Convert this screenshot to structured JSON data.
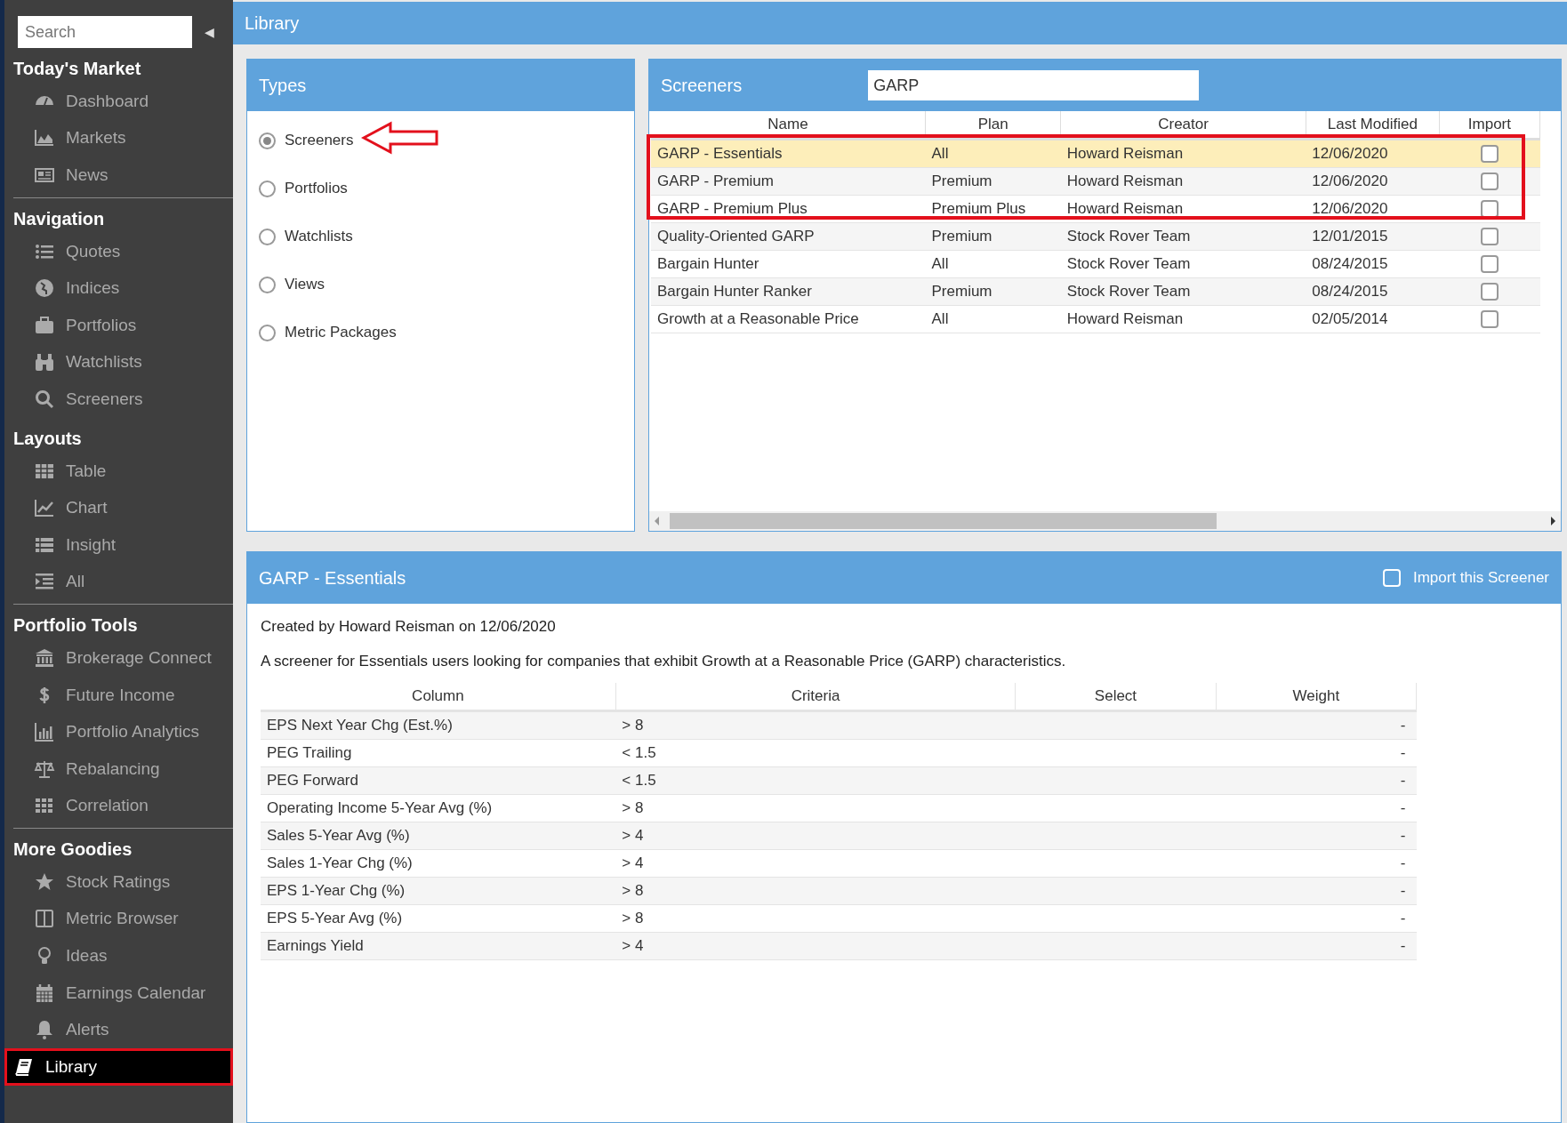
{
  "sidebar": {
    "search": {
      "placeholder": "Search"
    },
    "collapse": "◀",
    "sections": [
      {
        "title": "Today's Market",
        "items": [
          {
            "label": "Dashboard",
            "selected": false
          },
          {
            "label": "Markets",
            "selected": false
          },
          {
            "label": "News",
            "selected": false
          }
        ]
      },
      {
        "title": "Navigation",
        "items": [
          {
            "label": "Quotes",
            "selected": false
          },
          {
            "label": "Indices",
            "selected": false
          },
          {
            "label": "Portfolios",
            "selected": false
          },
          {
            "label": "Watchlists",
            "selected": false
          },
          {
            "label": "Screeners",
            "selected": false
          }
        ]
      },
      {
        "title": "Layouts",
        "items": [
          {
            "label": "Table",
            "selected": false
          },
          {
            "label": "Chart",
            "selected": false
          },
          {
            "label": "Insight",
            "selected": false
          },
          {
            "label": "All",
            "selected": false
          }
        ]
      },
      {
        "title": "Portfolio Tools",
        "items": [
          {
            "label": "Brokerage Connect",
            "selected": false
          },
          {
            "label": "Future Income",
            "selected": false
          },
          {
            "label": "Portfolio Analytics",
            "selected": false
          },
          {
            "label": "Rebalancing",
            "selected": false
          },
          {
            "label": "Correlation",
            "selected": false
          }
        ]
      },
      {
        "title": "More Goodies",
        "items": [
          {
            "label": "Stock Ratings",
            "selected": false
          },
          {
            "label": "Metric Browser",
            "selected": false
          },
          {
            "label": "Ideas",
            "selected": false
          },
          {
            "label": "Earnings Calendar",
            "selected": false
          },
          {
            "label": "Alerts",
            "selected": false
          },
          {
            "label": "Library",
            "selected": true
          }
        ]
      }
    ]
  },
  "header": {
    "title": "Library"
  },
  "types": {
    "title": "Types",
    "options": [
      {
        "label": "Screeners",
        "selected": true
      },
      {
        "label": "Portfolios",
        "selected": false
      },
      {
        "label": "Watchlists",
        "selected": false
      },
      {
        "label": "Views",
        "selected": false
      },
      {
        "label": "Metric Packages",
        "selected": false
      }
    ]
  },
  "screeners": {
    "title": "Screeners",
    "search": {
      "value": "GARP"
    },
    "columns": [
      "Name",
      "Plan",
      "Creator",
      "Last Modified",
      "Import"
    ],
    "rows": [
      {
        "name": "GARP - Essentials",
        "plan": "All",
        "creator": "Howard Reisman",
        "modified": "12/06/2020",
        "checked": false,
        "selected": true
      },
      {
        "name": "GARP - Premium",
        "plan": "Premium",
        "creator": "Howard Reisman",
        "modified": "12/06/2020",
        "checked": false,
        "selected": false
      },
      {
        "name": "GARP - Premium Plus",
        "plan": "Premium Plus",
        "creator": "Howard Reisman",
        "modified": "12/06/2020",
        "checked": false,
        "selected": false
      },
      {
        "name": "Quality-Oriented GARP",
        "plan": "Premium",
        "creator": "Stock Rover Team",
        "modified": "12/01/2015",
        "checked": false,
        "selected": false
      },
      {
        "name": "Bargain Hunter",
        "plan": "All",
        "creator": "Stock Rover Team",
        "modified": "08/24/2015",
        "checked": false,
        "selected": false
      },
      {
        "name": "Bargain Hunter Ranker",
        "plan": "Premium",
        "creator": "Stock Rover Team",
        "modified": "08/24/2015",
        "checked": false,
        "selected": false
      },
      {
        "name": "Growth at a Reasonable Price",
        "plan": "All",
        "creator": "Howard Reisman",
        "modified": "02/05/2014",
        "checked": false,
        "selected": false
      }
    ]
  },
  "detail": {
    "title": "GARP - Essentials",
    "import": {
      "label": "Import this Screener",
      "checked": false
    },
    "created": "Created by Howard Reisman on 12/06/2020",
    "description": "A screener for Essentials users looking for companies that exhibit Growth at a Reasonable Price (GARP) characteristics.",
    "columns": [
      "Column",
      "Criteria",
      "Select",
      "Weight"
    ],
    "rows": [
      {
        "column": "EPS Next Year Chg (Est.%)",
        "criteria": "> 8",
        "weight": "-"
      },
      {
        "column": "PEG Trailing",
        "criteria": "< 1.5",
        "weight": "-"
      },
      {
        "column": "PEG Forward",
        "criteria": "< 1.5",
        "weight": "-"
      },
      {
        "column": "Operating Income 5-Year Avg (%)",
        "criteria": "> 8",
        "weight": "-"
      },
      {
        "column": "Sales 5-Year Avg (%)",
        "criteria": "> 4",
        "weight": "-"
      },
      {
        "column": "Sales 1-Year Chg (%)",
        "criteria": "> 4",
        "weight": "-"
      },
      {
        "column": "EPS 1-Year Chg (%)",
        "criteria": "> 8",
        "weight": "-"
      },
      {
        "column": "EPS 5-Year Avg (%)",
        "criteria": "> 8",
        "weight": "-"
      },
      {
        "column": "Earnings Yield",
        "criteria": "> 4",
        "weight": "-"
      }
    ]
  }
}
